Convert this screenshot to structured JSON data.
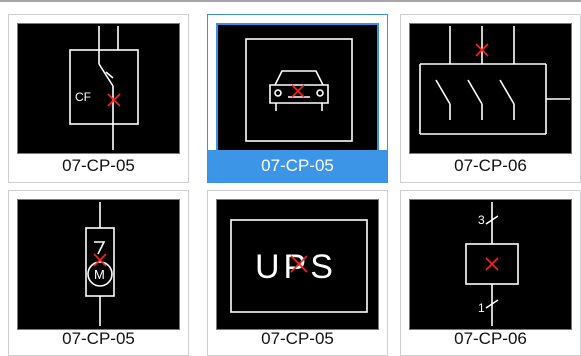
{
  "items": [
    {
      "label": "07-CP-05",
      "selected": false,
      "icon": "circuit-breaker-symbol-icon"
    },
    {
      "label": "07-CP-05",
      "selected": true,
      "icon": "car-charger-symbol-icon"
    },
    {
      "label": "07-CP-06",
      "selected": false,
      "icon": "three-pole-switch-symbol-icon"
    },
    {
      "label": "07-CP-05",
      "selected": false,
      "icon": "motor-symbol-icon"
    },
    {
      "label": "07-CP-05",
      "selected": false,
      "icon": "ups-symbol-icon",
      "text": "UPS"
    },
    {
      "label": "07-CP-06",
      "selected": false,
      "icon": "junction-box-symbol-icon",
      "top_mark": "3",
      "bottom_mark": "1"
    }
  ],
  "symbols": {
    "cf_text": "CF",
    "motor_text": "M"
  },
  "colors": {
    "selected_bg": "#3c95e6",
    "thumb_bg": "#000000",
    "marker": "#ff2020"
  }
}
